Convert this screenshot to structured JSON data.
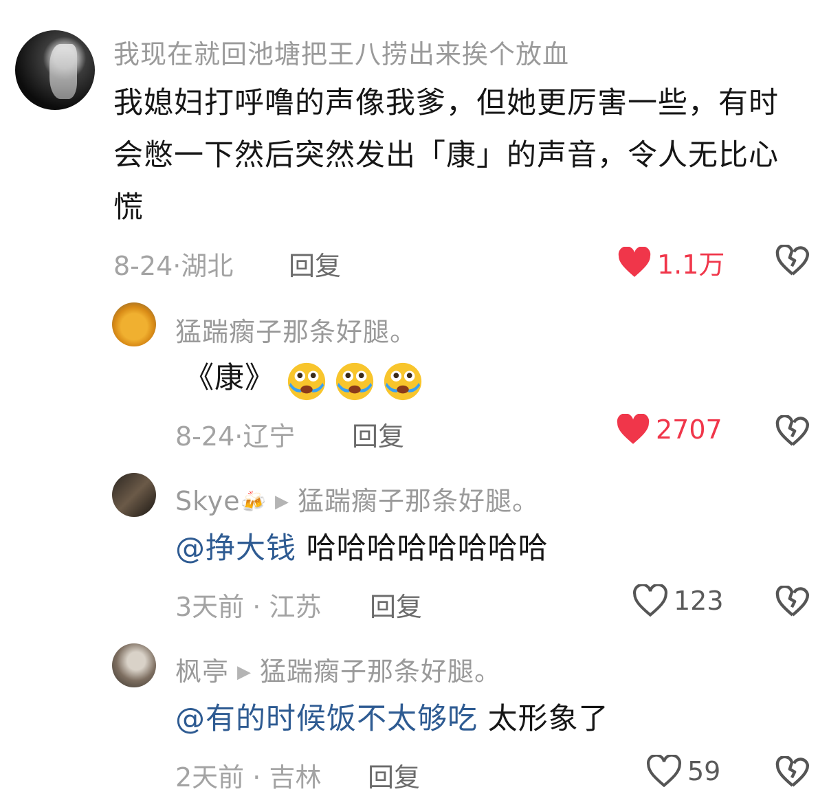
{
  "comments": [
    {
      "username": "我现在就回池塘把王八捞出来挨个放血",
      "text": "我媳妇打呼噜的声像我爹，但她更厉害一些，有时会憋一下然后突然发出「康」的声音，令人无比心慌",
      "date": "8-24",
      "location": "湖北",
      "reply_label": "回复",
      "likes": "1.1万",
      "liked": true
    },
    {
      "username": "猛踹瘸子那条好腿。",
      "text": "《康》",
      "emojis": [
        "crying-face",
        "crying-face",
        "crying-face"
      ],
      "date": "8-24",
      "location": "辽宁",
      "reply_label": "回复",
      "likes": "2707",
      "liked": true
    },
    {
      "username": "Skye",
      "username_emoji": "🍻",
      "reply_to": "猛踹瘸子那条好腿。",
      "mention": "@挣大钱",
      "text": "哈哈哈哈哈哈哈哈",
      "date": "3天前",
      "location": "江苏",
      "reply_label": "回复",
      "likes": "123",
      "liked": false
    },
    {
      "username": "枫亭",
      "reply_to": "猛踹瘸子那条好腿。",
      "mention": "@有的时候饭不太够吃",
      "text": "太形象了",
      "date": "2天前",
      "location": "吉林",
      "reply_label": "回复",
      "likes": "59",
      "liked": false
    }
  ],
  "colors": {
    "liked": "#f0364a",
    "mention": "#2e5b92",
    "muted": "#9a9a9a"
  }
}
